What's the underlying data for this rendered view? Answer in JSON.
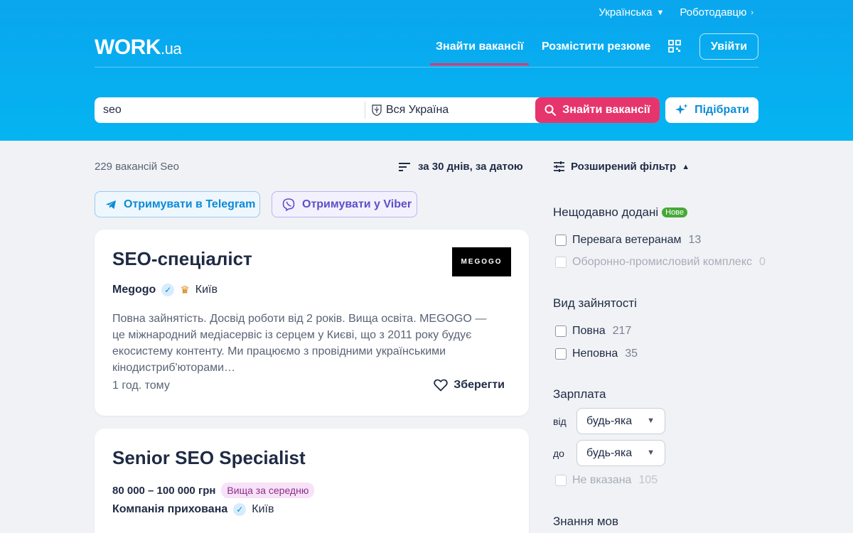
{
  "header": {
    "language": "Українська",
    "employer": "Роботодавцю",
    "logo_main": "WORK",
    "logo_suffix": ".ua",
    "nav": [
      "Знайти вакансії",
      "Розмістити резюме"
    ],
    "login": "Увійти"
  },
  "search": {
    "query": "seo",
    "location": "Вся Україна",
    "submit": "Знайти вакансії",
    "pick": "Підібрати"
  },
  "results": {
    "count": "229 вакансій Seo",
    "sort": "за 30 днів, за датою",
    "telegram": "Отримувати в Telegram",
    "viber": "Отримувати у Viber"
  },
  "cards": [
    {
      "title": "SEO-спеціаліст",
      "company": "Megogo",
      "city": "Київ",
      "logo": "MEGOGO",
      "description": "Повна зайнятість. Досвід роботи від 2 років. Вища освіта. MEGOGO — це міжнародний медіасервіс із серцем у Києві, що з 2011 року будує екосистему контенту. Ми працюємо з провідними українськими кінодистриб'юторами…",
      "time": "1 год. тому",
      "save": "Зберегти"
    },
    {
      "title": "Senior SEO Specialist",
      "salary": "80 000 – 100 000 грн",
      "salary_badge": "Вища за середню",
      "company": "Компанія прихована",
      "city": "Київ"
    }
  ],
  "sidebar": {
    "advanced": "Розширений фільтр",
    "recent": {
      "title": "Нещодавно додані",
      "badge": "Нове",
      "items": [
        {
          "label": "Перевага ветеранам",
          "count": "13"
        },
        {
          "label": "Оборонно-промисловий комплекс",
          "count": "0"
        }
      ]
    },
    "employment": {
      "title": "Вид зайнятості",
      "items": [
        {
          "label": "Повна",
          "count": "217"
        },
        {
          "label": "Неповна",
          "count": "35"
        }
      ]
    },
    "salary": {
      "title": "Зарплата",
      "from_label": "від",
      "to_label": "до",
      "from_value": "будь-яка",
      "to_value": "будь-яка",
      "not_specified": {
        "label": "Не вказана",
        "count": "105"
      }
    },
    "languages": {
      "title": "Знання мов"
    }
  }
}
